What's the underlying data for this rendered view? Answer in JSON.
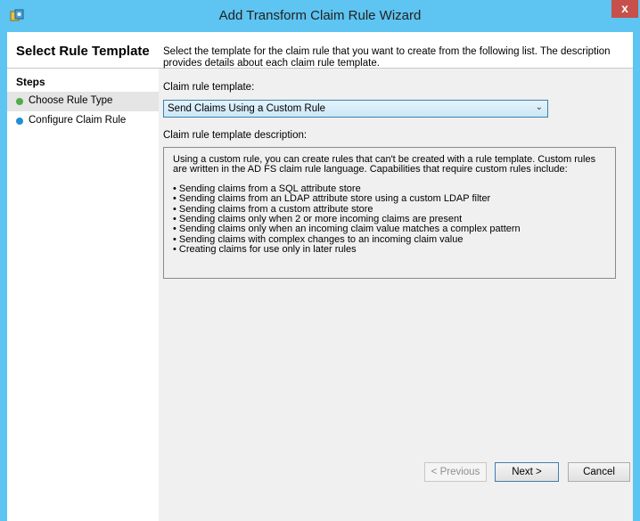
{
  "window": {
    "title": "Add Transform Claim Rule Wizard",
    "close_label": "x",
    "icon": "claim-wizard-icon",
    "accent": "#5ec4f1"
  },
  "header": {
    "title": "Select Rule Template"
  },
  "steps": {
    "title": "Steps",
    "items": [
      {
        "label": "Choose Rule Type",
        "status": "current",
        "color": "#4cae4c"
      },
      {
        "label": "Configure Claim Rule",
        "status": "pending",
        "color": "#1f8fd6"
      }
    ]
  },
  "main": {
    "intro": "Select the template for the claim rule that you want to create from the following list. The description provides details about each claim rule template.",
    "template_label": "Claim rule template:",
    "template_value": "Send Claims Using a Custom Rule",
    "description_label": "Claim rule template description:",
    "description_intro": "Using a custom rule, you can create rules that can't be created with a rule template.  Custom rules are written in the AD FS claim rule language.  Capabilities that require custom rules include:",
    "description_items": [
      "• Sending claims from a SQL attribute store",
      "• Sending claims from an LDAP attribute store using a custom LDAP filter",
      "• Sending claims from a custom attribute store",
      "• Sending claims only when 2 or more incoming claims are present",
      "• Sending claims only when an incoming claim value matches a complex pattern",
      "• Sending claims with complex changes to an incoming claim value",
      "• Creating claims for use only in later rules"
    ]
  },
  "buttons": {
    "previous": "< Previous",
    "next": "Next >",
    "cancel": "Cancel"
  }
}
